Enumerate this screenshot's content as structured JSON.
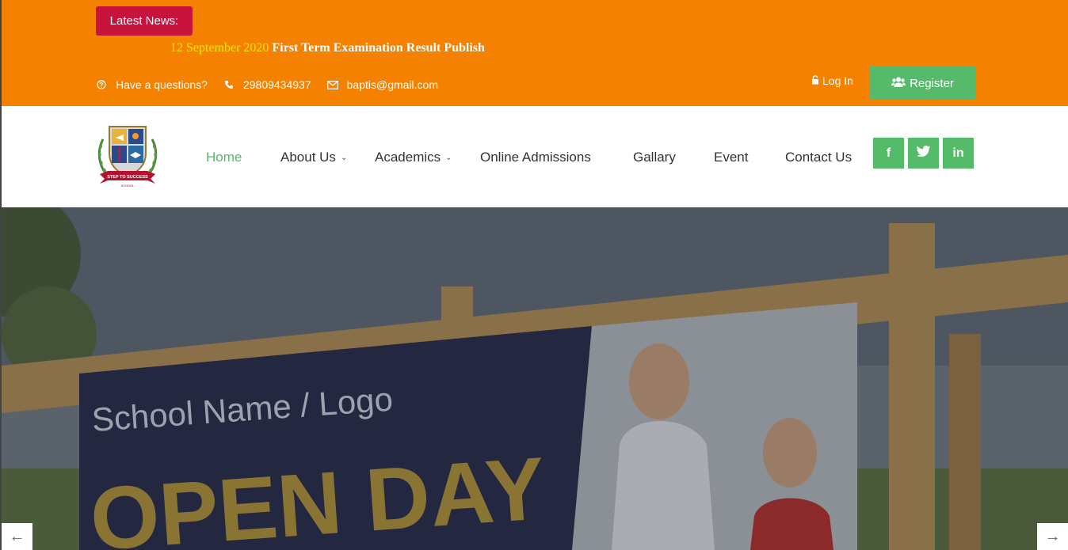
{
  "topbar": {
    "news_label": "Latest News:",
    "news_date": "12 September 2020",
    "news_text": "First Term Examination Result Publish",
    "question_text": "Have a questions?",
    "phone": "29809434937",
    "email": "baptis@gmail.com",
    "login_label": "Log In",
    "register_label": "Register"
  },
  "nav": {
    "items": [
      {
        "label": "Home"
      },
      {
        "label": "About Us"
      },
      {
        "label": "Academics"
      },
      {
        "label": "Online Admissions"
      },
      {
        "label": "Gallary"
      },
      {
        "label": "Event"
      },
      {
        "label": "Contact Us"
      }
    ],
    "social": [
      "f",
      "twitter-icon",
      "in"
    ]
  },
  "logo": {
    "banner_text": "STEP TO SUCCESS",
    "sub_text": "SCHOOL"
  },
  "hero": {
    "sign_school": "School Name / Logo",
    "sign_headline": "OPEN DAY"
  },
  "colors": {
    "topbar": "#f58100",
    "badge": "#c8143c",
    "accent_green": "#55bb6b",
    "news_date": "#ffe600"
  }
}
